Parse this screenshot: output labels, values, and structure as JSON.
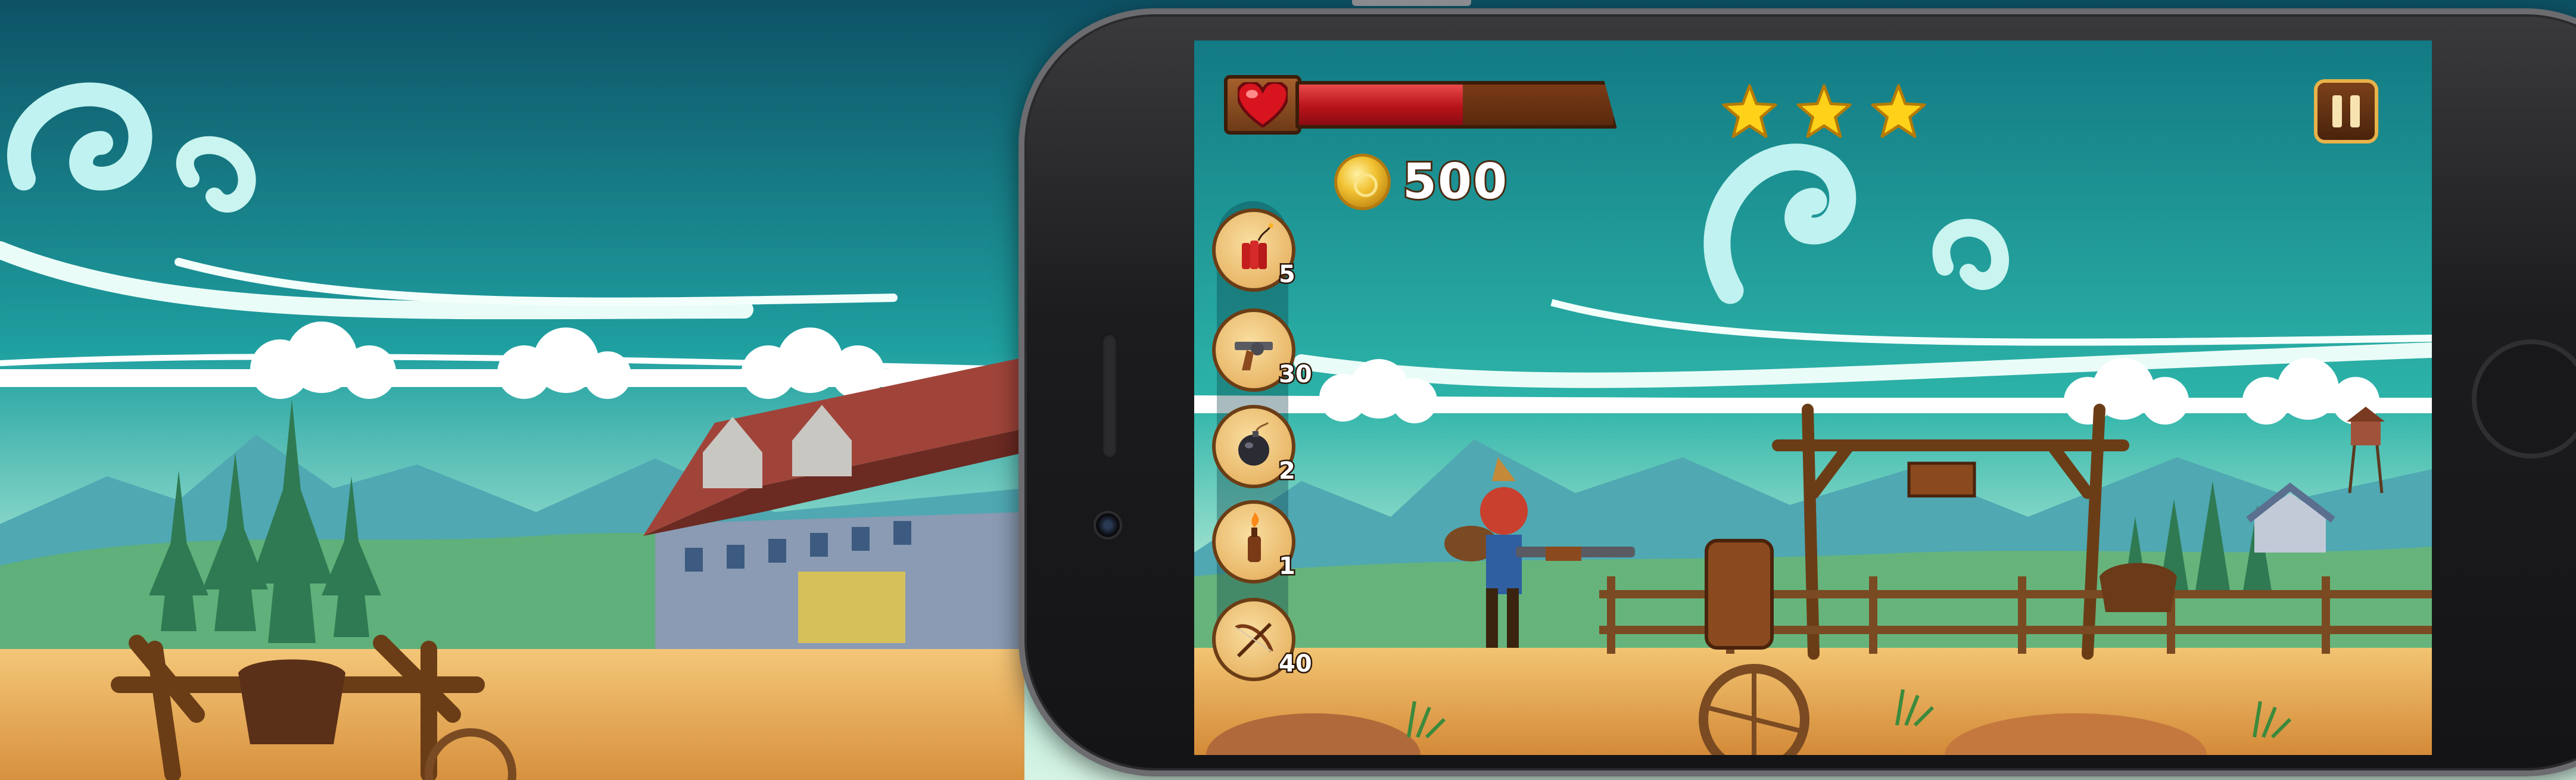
{
  "hud": {
    "health": {
      "level": 0.52
    },
    "stars": {
      "earned": 3,
      "total": 3
    },
    "coins": "500"
  },
  "weapons": [
    {
      "icon": "dynamite-icon",
      "count": "5"
    },
    {
      "icon": "revolver-icon",
      "count": "30"
    },
    {
      "icon": "bomb-icon",
      "count": "2"
    },
    {
      "icon": "molotov-icon",
      "count": "1"
    },
    {
      "icon": "crossbow-icon",
      "count": "40"
    }
  ],
  "colors": {
    "sky_top": "#127a84",
    "sky_bottom": "#c9f0dc",
    "ground": "#e8b262",
    "health_red": "#c8161e",
    "star_gold": "#ffd21a"
  }
}
